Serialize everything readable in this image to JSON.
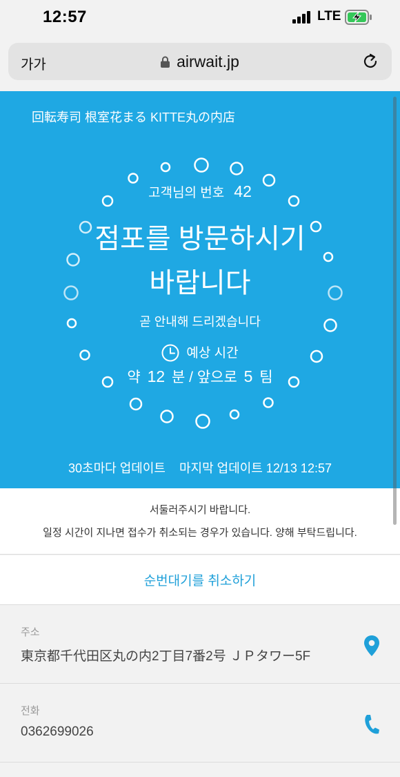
{
  "status_bar": {
    "time": "12:57",
    "network": "LTE"
  },
  "browser": {
    "text_size": "가가",
    "domain": "airwait.jp"
  },
  "hero": {
    "store_name": "回転寿司 根室花まる KITTE丸の内店",
    "customer_number_label": "고객님의 번호",
    "customer_number": "42",
    "headline_line1": "점포를 방문하시기",
    "headline_line2": "바랍니다",
    "notify_text": "곧 안내해 드리겠습니다",
    "estimate_label": "예상 시간",
    "estimate_prefix": "약",
    "estimate_minutes": "12",
    "estimate_minutes_unit": "분 / 앞으로",
    "estimate_groups": "5",
    "estimate_groups_unit": "팀",
    "update_interval": "30초마다 업데이트",
    "last_update": "마지막 업데이트 12/13 12:57"
  },
  "notice": {
    "line1": "서둘러주시기 바랍니다.",
    "line2": "일정 시간이 지나면 접수가 취소되는 경우가 있습니다. 양해 부탁드립니다."
  },
  "cancel_label": "순번대기를 취소하기",
  "address": {
    "label": "주소",
    "value": "東京都千代田区丸の内2丁目7番2号 ＪＰタワー5F"
  },
  "phone": {
    "label": "전화",
    "value": "0362699026"
  },
  "colors": {
    "hero_bg": "#1fa8e3",
    "accent": "#1fa0d9"
  },
  "icons": [
    "lock-icon",
    "reload-icon",
    "clock-icon",
    "map-pin-icon",
    "phone-icon",
    "battery-charging-icon",
    "signal-icon"
  ]
}
